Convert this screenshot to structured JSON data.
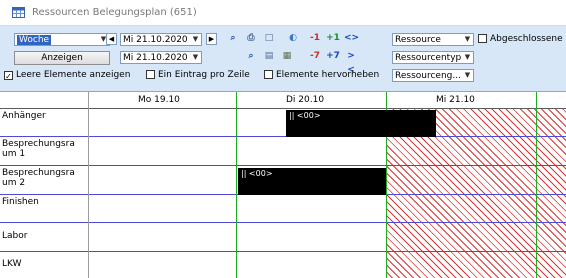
{
  "window": {
    "title": "Ressourcen Belegungsplan (651)"
  },
  "toolbar": {
    "view_select": {
      "value": "Woche"
    },
    "date_from": {
      "value": "Mi 21.10.2020"
    },
    "date_to": {
      "value": "Mi 21.10.2020"
    },
    "show_button_label": "Anzeigen",
    "zoom_buttons": [
      "-1",
      "+1",
      "-7",
      "+7"
    ],
    "resource_select": {
      "value": "Ressource"
    },
    "resource_type_select": {
      "value": "Ressourcentyp"
    },
    "resource_group_select": {
      "value": "Ressourceng..."
    },
    "checkbox_closed": {
      "label": "Abgeschlossene",
      "checked": false
    },
    "checkbox_empty": {
      "label": "Leere Elemente anzeigen",
      "checked": true
    },
    "checkbox_one_per_row": {
      "label": "Ein Eintrag pro Zeile",
      "checked": false
    },
    "checkbox_highlight": {
      "label": "Elemente hervorheben",
      "checked": false
    }
  },
  "schedule": {
    "days": [
      "Mo 19.10",
      "Di 20.10",
      "Mi 21.10"
    ],
    "resources": [
      "Anhänger",
      "Besprechungsra um 1",
      "Besprechungsra um 2",
      "Finishen",
      "Labor",
      "LKW"
    ],
    "bookings": [
      {
        "resource": "Anhänger",
        "label": "|| <00>"
      },
      {
        "resource": "Besprechungsra um 2",
        "label": "|| <00>"
      }
    ],
    "colors": {
      "booking": "#000000",
      "hatch": "#dd3333",
      "row_line": "#4b4bd8",
      "today_line": "#22aa22",
      "toolbar_bg": "#d7e7f8"
    }
  }
}
